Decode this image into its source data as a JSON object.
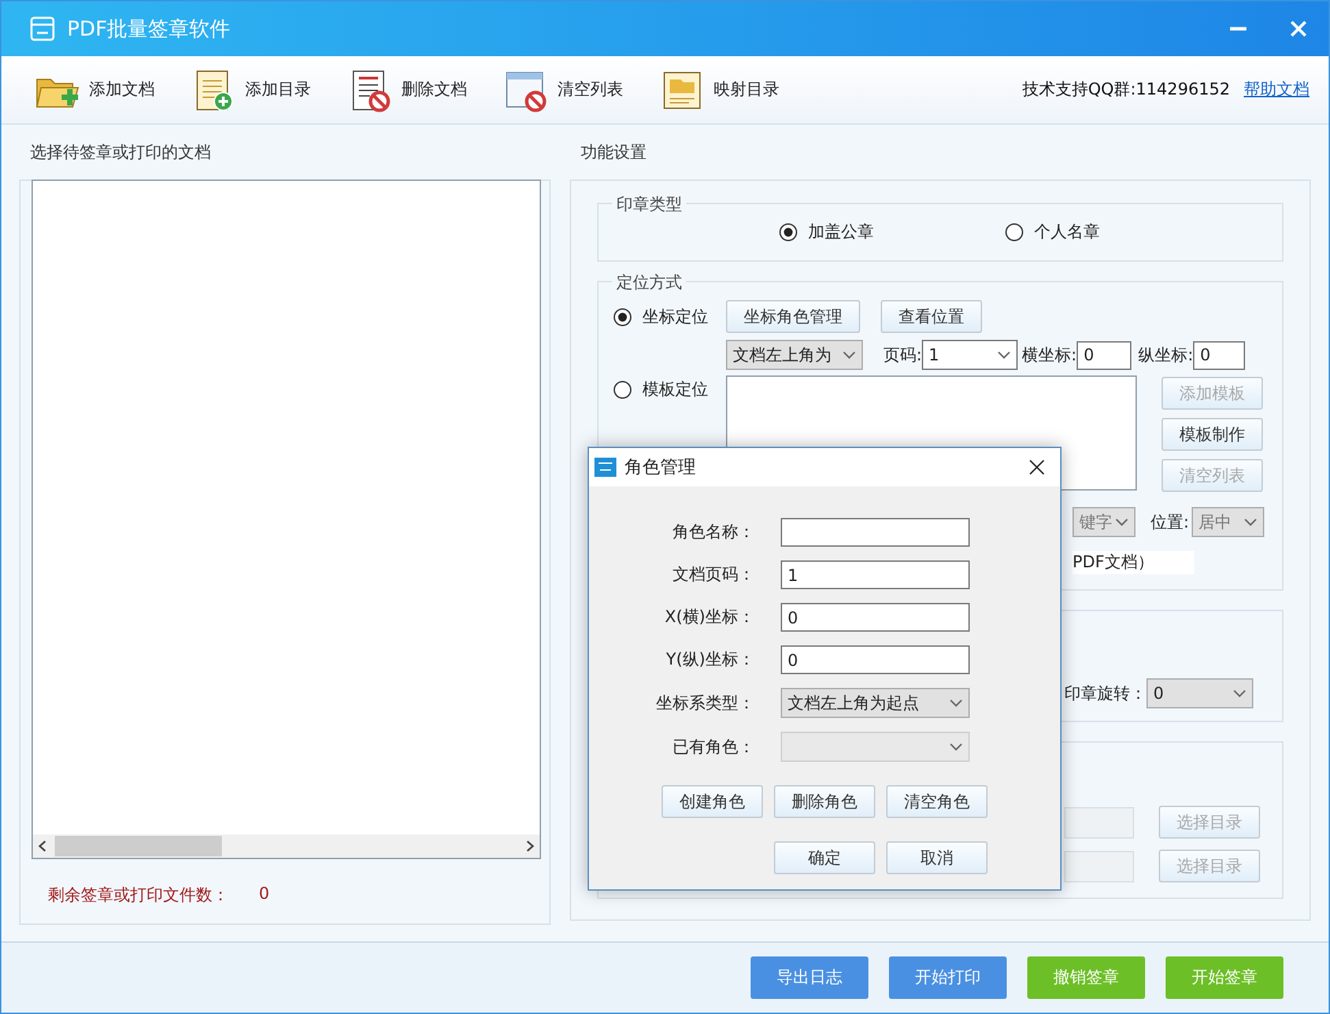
{
  "window": {
    "title": "PDF批量签章软件"
  },
  "toolbar": [
    {
      "label": "添加文档",
      "kind": "add-doc"
    },
    {
      "label": "添加目录",
      "kind": "add-dir"
    },
    {
      "label": "删除文档",
      "kind": "delete-doc"
    },
    {
      "label": "清空列表",
      "kind": "clear-list"
    },
    {
      "label": "映射目录",
      "kind": "map-dir"
    }
  ],
  "support": {
    "text": "技术支持QQ群:114296152",
    "link": "帮助文档"
  },
  "file_panel": {
    "title": "选择待签章或打印的文档",
    "counter_label": "剩余签章或打印文件数：",
    "counter_value": "0"
  },
  "settings": {
    "title": "功能设置",
    "seal_type": {
      "legend": "印章类型",
      "options": [
        {
          "label": "加盖公章",
          "selected": true
        },
        {
          "label": "个人名章",
          "selected": false
        }
      ]
    },
    "positioning": {
      "legend": "定位方式",
      "modes": [
        {
          "label": "坐标定位",
          "selected": true
        },
        {
          "label": "模板定位",
          "selected": false
        }
      ],
      "role_button": "坐标角色管理",
      "view_button": "查看位置",
      "coord_select": "文档左上角为",
      "page_label": "页码:",
      "page_value": "1",
      "x_label": "横坐标:",
      "x_value": "0",
      "y_label": "纵坐标:",
      "y_value": "0",
      "template_buttons": [
        {
          "label": "添加模板",
          "disabled": true
        },
        {
          "label": "模板制作",
          "disabled": false
        },
        {
          "label": "清空列表",
          "disabled": true
        }
      ],
      "keyword_select": "键字",
      "position_label": "位置:",
      "position_select": "居中",
      "note": "PDF文档）"
    },
    "rotation": {
      "label": "印章旋转：",
      "value": "0"
    },
    "directories": [
      {
        "button": "选择目录"
      },
      {
        "button": "选择目录"
      }
    ]
  },
  "dialog": {
    "title": "角色管理",
    "fields": [
      {
        "label": "角色名称：",
        "kind": "input"
      },
      {
        "label": "文档页码：",
        "kind": "input",
        "value": "1"
      },
      {
        "label": "X(横)坐标：",
        "kind": "input",
        "value": "0"
      },
      {
        "label": "Y(纵)坐标：",
        "kind": "input",
        "value": "0"
      },
      {
        "label": "坐标系类型：",
        "kind": "select",
        "value": "文档左上角为起点",
        "disabled": false
      },
      {
        "label": "已有角色：",
        "kind": "select",
        "disabled": true
      }
    ],
    "role_buttons": [
      "创建角色",
      "删除角色",
      "清空角色"
    ],
    "confirm_buttons": [
      "确定",
      "取消"
    ]
  },
  "actions": [
    {
      "label": "导出日志",
      "color": "#4a90e2"
    },
    {
      "label": "开始打印",
      "color": "#4a90e2"
    },
    {
      "label": "撤销签章",
      "color": "#6cbf26"
    },
    {
      "label": "开始签章",
      "color": "#6cbf26"
    }
  ]
}
